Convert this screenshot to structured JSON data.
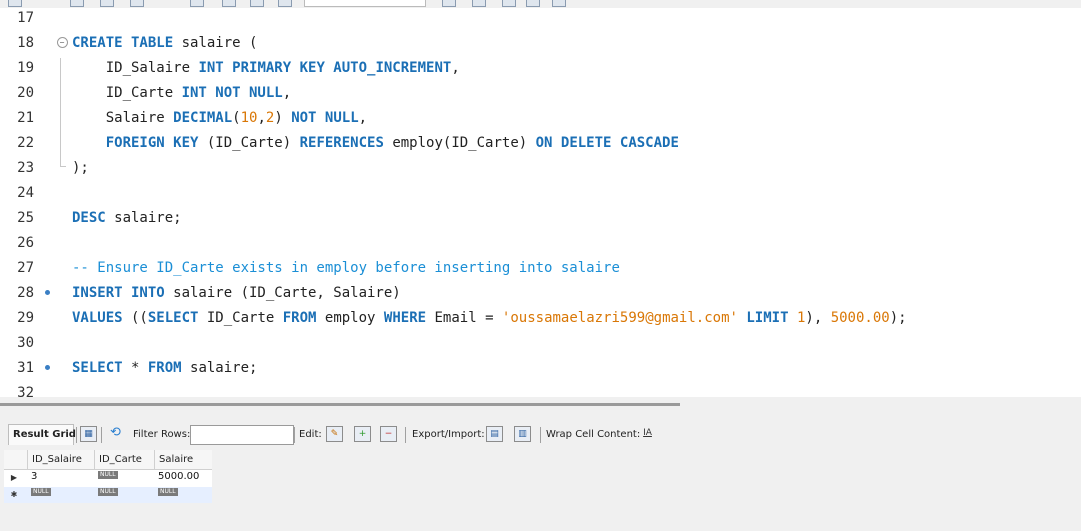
{
  "editor": {
    "lines": [
      {
        "n": "17",
        "marker": "",
        "tokens": []
      },
      {
        "n": "18",
        "marker": "fold",
        "tokens": [
          [
            "kw",
            "CREATE TABLE"
          ],
          [
            "id",
            " salaire ("
          ]
        ]
      },
      {
        "n": "19",
        "marker": "",
        "tokens": [
          [
            "id",
            "    ID_Salaire "
          ],
          [
            "kw",
            "INT PRIMARY KEY AUTO_INCREMENT"
          ],
          [
            "id",
            ","
          ]
        ]
      },
      {
        "n": "20",
        "marker": "",
        "tokens": [
          [
            "id",
            "    ID_Carte "
          ],
          [
            "kw",
            "INT NOT NULL"
          ],
          [
            "id",
            ","
          ]
        ]
      },
      {
        "n": "21",
        "marker": "",
        "tokens": [
          [
            "id",
            "    Salaire "
          ],
          [
            "kw",
            "DECIMAL"
          ],
          [
            "id",
            "("
          ],
          [
            "num",
            "10"
          ],
          [
            "id",
            ","
          ],
          [
            "num",
            "2"
          ],
          [
            "id",
            ") "
          ],
          [
            "kw",
            "NOT NULL"
          ],
          [
            "id",
            ","
          ]
        ]
      },
      {
        "n": "22",
        "marker": "",
        "tokens": [
          [
            "id",
            "    "
          ],
          [
            "kw",
            "FOREIGN KEY"
          ],
          [
            "id",
            " (ID_Carte) "
          ],
          [
            "kw",
            "REFERENCES"
          ],
          [
            "id",
            " employ(ID_Carte) "
          ],
          [
            "kw",
            "ON DELETE CASCADE"
          ]
        ]
      },
      {
        "n": "23",
        "marker": "",
        "tokens": [
          [
            "id",
            ");"
          ]
        ]
      },
      {
        "n": "24",
        "marker": "",
        "tokens": []
      },
      {
        "n": "25",
        "marker": "",
        "tokens": [
          [
            "kw",
            "DESC"
          ],
          [
            "id",
            " salaire;"
          ]
        ]
      },
      {
        "n": "26",
        "marker": "",
        "tokens": []
      },
      {
        "n": "27",
        "marker": "",
        "tokens": [
          [
            "cmt",
            "-- Ensure ID_Carte exists in employ before inserting into salaire"
          ]
        ]
      },
      {
        "n": "28",
        "marker": "dot",
        "tokens": [
          [
            "kw",
            "INSERT INTO"
          ],
          [
            "id",
            " salaire (ID_Carte, Salaire)"
          ]
        ]
      },
      {
        "n": "29",
        "marker": "",
        "tokens": [
          [
            "kw",
            "VALUES"
          ],
          [
            "id",
            " (("
          ],
          [
            "kw",
            "SELECT"
          ],
          [
            "id",
            " ID_Carte "
          ],
          [
            "kw",
            "FROM"
          ],
          [
            "id",
            " employ "
          ],
          [
            "kw",
            "WHERE"
          ],
          [
            "id",
            " Email = "
          ],
          [
            "str",
            "'oussamaelazri599@gmail.com'"
          ],
          [
            "id",
            " "
          ],
          [
            "kw",
            "LIMIT"
          ],
          [
            "id",
            " "
          ],
          [
            "num",
            "1"
          ],
          [
            "id",
            "), "
          ],
          [
            "num",
            "5000.00"
          ],
          [
            "id",
            ");"
          ]
        ]
      },
      {
        "n": "30",
        "marker": "",
        "tokens": []
      },
      {
        "n": "31",
        "marker": "dot",
        "tokens": [
          [
            "kw",
            "SELECT"
          ],
          [
            "id",
            " * "
          ],
          [
            "kw",
            "FROM"
          ],
          [
            "id",
            " salaire;"
          ]
        ]
      },
      {
        "n": "32",
        "marker": "",
        "tokens": []
      }
    ]
  },
  "result_toolbar": {
    "result_grid_label": "Result Grid",
    "filter_rows_label": "Filter Rows:",
    "filter_rows_value": "",
    "edit_label": "Edit:",
    "export_import_label": "Export/Import:",
    "wrap_cell_label": "Wrap Cell Content:"
  },
  "grid": {
    "columns": [
      "ID_Salaire",
      "ID_Carte",
      "Salaire"
    ],
    "null_text": "NULL",
    "rows": [
      {
        "marker": "▶",
        "cells": [
          "3",
          null,
          "5000.00"
        ]
      },
      {
        "marker": "✱",
        "cells": [
          null,
          null,
          null
        ]
      }
    ]
  }
}
